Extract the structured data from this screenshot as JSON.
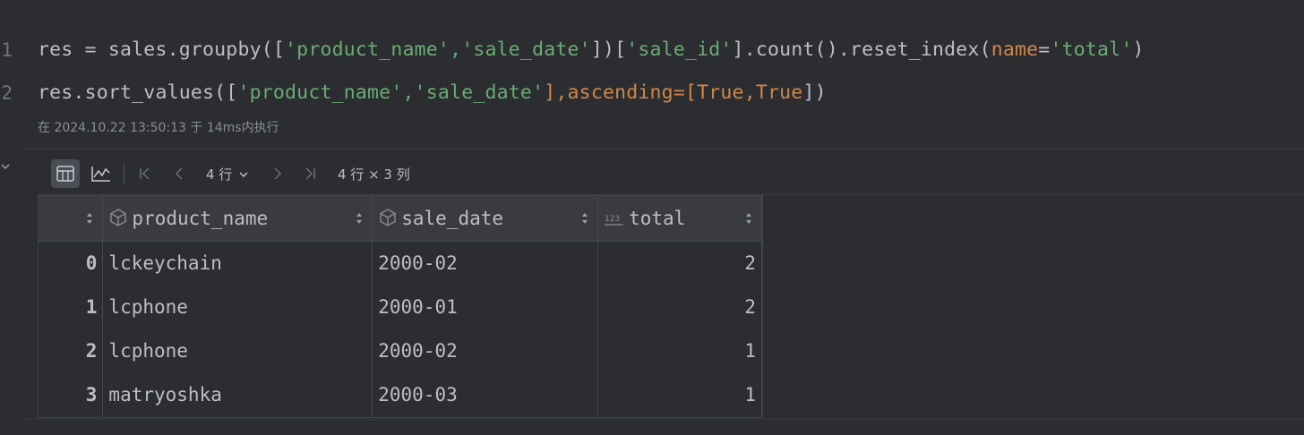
{
  "editor": {
    "line_numbers": [
      "1",
      "2"
    ],
    "exec_info": "在 2024.10.22 13:50:13 于 14ms内执行"
  },
  "code": {
    "line1": {
      "t1": "res = sales.groupby([",
      "s1": "'product_name'",
      "c1": ",",
      "s2": "'sale_date'",
      "t2": "])[",
      "s3": "'sale_id'",
      "t3": "].count().reset_index(",
      "k1": "name",
      "eq": "=",
      "s4": "'total'",
      "t4": ")"
    },
    "line2": {
      "t1": "res.sort_values([",
      "s1": "'product_name'",
      "c1": ",",
      "s2": "'sale_date'",
      "t2": "],",
      "k1": "ascending",
      "eq": "=[",
      "k2": "True",
      "c2": ",",
      "k3": "True",
      "t3": "])"
    }
  },
  "toolbar": {
    "rows_select": "4 行",
    "shape": "4 行 × 3 列",
    "icons": [
      "table-view-icon",
      "chart-view-icon",
      "first-page-icon",
      "prev-page-icon",
      "chevron-down-icon",
      "next-page-icon",
      "last-page-icon"
    ]
  },
  "table": {
    "columns": [
      {
        "label": "",
        "icon": ""
      },
      {
        "label": "product_name",
        "icon": "cube-icon"
      },
      {
        "label": "sale_date",
        "icon": "cube-icon"
      },
      {
        "label": "total",
        "icon": "numeric-123-icon"
      }
    ],
    "rows": [
      {
        "index": "0",
        "product_name": "lckeychain",
        "sale_date": "2000-02",
        "total": "2"
      },
      {
        "index": "1",
        "product_name": "lcphone",
        "sale_date": "2000-01",
        "total": "2"
      },
      {
        "index": "2",
        "product_name": "lcphone",
        "sale_date": "2000-02",
        "total": "1"
      },
      {
        "index": "3",
        "product_name": "matryoshka",
        "sale_date": "2000-03",
        "total": "1"
      }
    ]
  },
  "colors": {
    "background": "#2b2d30",
    "header_bg": "#393b40",
    "string": "#6aab73",
    "keyword": "#d1874a",
    "text": "#bcbec4"
  }
}
